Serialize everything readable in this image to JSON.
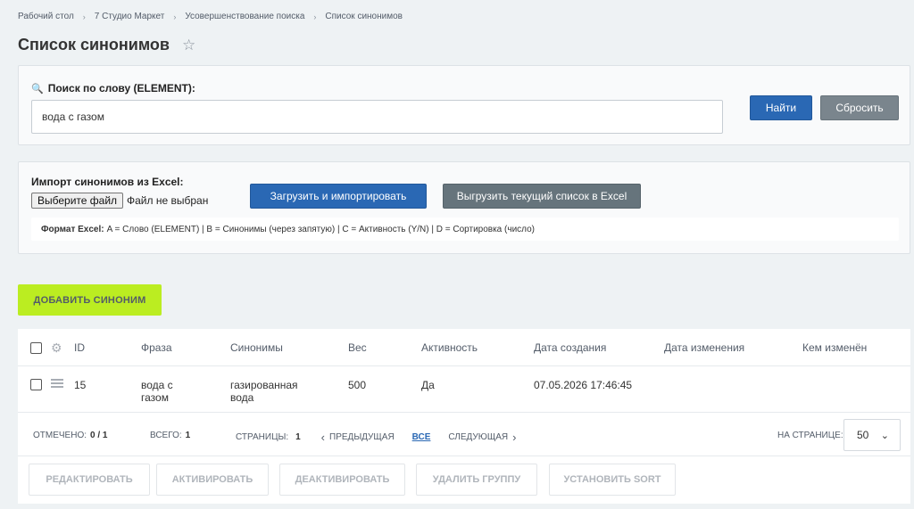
{
  "breadcrumb": {
    "items": [
      "Рабочий стол",
      "7 Студио Маркет",
      "Усовершенствование поиска",
      "Список синонимов"
    ],
    "separator": "›"
  },
  "page": {
    "title": "Список синонимов",
    "star_icon": "star-icon"
  },
  "search": {
    "label": "Поиск по слову (ELEMENT):",
    "value": "вода с газом",
    "find_label": "Найти",
    "reset_label": "Сбросить"
  },
  "import": {
    "label": "Импорт синонимов из Excel:",
    "file_button": "Выберите файл",
    "file_status": "Файл не выбран",
    "upload_label": "Загрузить и импортировать",
    "export_label": "Выгрузить текущий список в Excel",
    "format_title": "Формат Excel:",
    "format_text": "A = Слово (ELEMENT) | B = Синонимы (через запятую) | C = Активность (Y/N) | D = Сортировка (число)"
  },
  "add_button": "ДОБАВИТЬ СИНОНИМ",
  "table": {
    "columns": [
      "ID",
      "Фраза",
      "Синонимы",
      "Вес",
      "Активность",
      "Дата создания",
      "Дата изменения",
      "Кем изменён"
    ],
    "rows": [
      {
        "id": "15",
        "phrase_line1": "вода с",
        "phrase_line2": "газом",
        "synonyms_line1": "газированная",
        "synonyms_line2": "вода",
        "weight": "500",
        "active": "Да",
        "created": "07.05.2026 17:46:45",
        "modified": "",
        "modified_by": ""
      }
    ]
  },
  "footer": {
    "selected_label": "Отмечено:",
    "selected_value": "0 / 1",
    "total_label": "Всего:",
    "total_value": "1",
    "pages_label": "Страницы:",
    "pages_value": "1",
    "prev_label": "Предыдущая",
    "all_label": "ВСЕ",
    "next_label": "Следующая",
    "per_page_label": "На странице:",
    "per_page_value": "50"
  },
  "actions": [
    "РЕДАКТИРОВАТЬ",
    "АКТИВИРОВАТЬ",
    "ДЕАКТИВИРОВАТЬ",
    "УДАЛИТЬ ГРУППУ",
    "УСТАНОВИТЬ SORT"
  ],
  "colors": {
    "primary_button": "#2a68b4",
    "secondary_button": "#7a858d",
    "add_button": "#bbed21",
    "background": "#eef2f4"
  }
}
